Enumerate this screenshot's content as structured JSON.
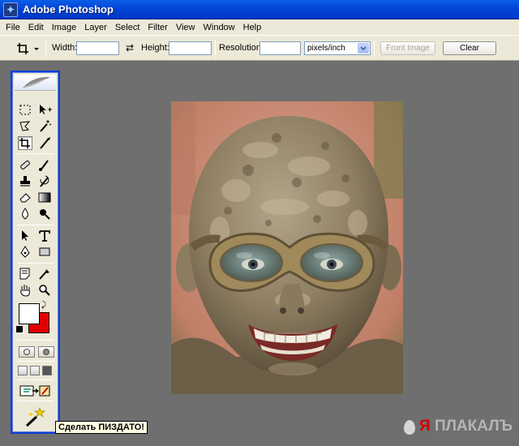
{
  "window": {
    "title": "Adobe Photoshop",
    "app_icon": "photoshop-icon"
  },
  "menubar": {
    "items": [
      "File",
      "Edit",
      "Image",
      "Layer",
      "Select",
      "Filter",
      "View",
      "Window",
      "Help"
    ]
  },
  "options": {
    "width_label": "Width:",
    "height_label": "Height:",
    "resolution_label": "Resolution:",
    "width_value": "",
    "height_value": "",
    "resolution_value": "",
    "units_selected": "pixels/inch",
    "front_image_label": "Front Image",
    "clear_label": "Clear",
    "swap_icon": "swap-arrows-icon",
    "tool_icon": "crop-icon"
  },
  "toolbox": {
    "foreground_color": "#ffffff",
    "background_color": "#e00000",
    "active_tool": "crop"
  },
  "tooltip": {
    "text": "Сделать ПИЗДАТО!"
  },
  "watermark": {
    "first_letter": "Я",
    "rest": "ПЛАКАЛЪ"
  }
}
